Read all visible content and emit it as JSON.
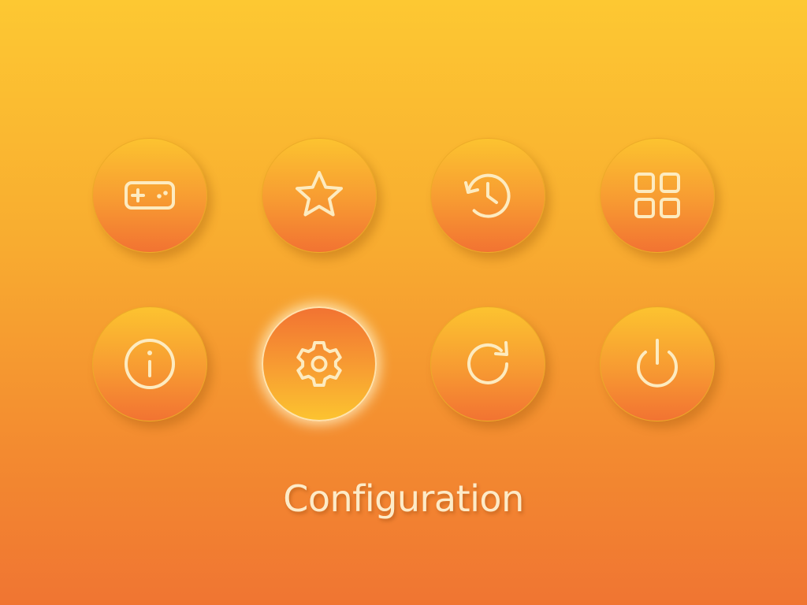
{
  "menu": {
    "selected_label": "Configuration",
    "items": [
      {
        "icon": "gamepad-icon",
        "selected": false
      },
      {
        "icon": "star-icon",
        "selected": false
      },
      {
        "icon": "history-icon",
        "selected": false
      },
      {
        "icon": "grid-icon",
        "selected": false
      },
      {
        "icon": "info-icon",
        "selected": false
      },
      {
        "icon": "gear-icon",
        "selected": true
      },
      {
        "icon": "refresh-icon",
        "selected": false
      },
      {
        "icon": "power-icon",
        "selected": false
      }
    ]
  },
  "colors": {
    "background_top": "#fdc832",
    "background_bottom": "#f07532",
    "icon_stroke": "#fdebc0",
    "label_text": "#fdebc8"
  }
}
